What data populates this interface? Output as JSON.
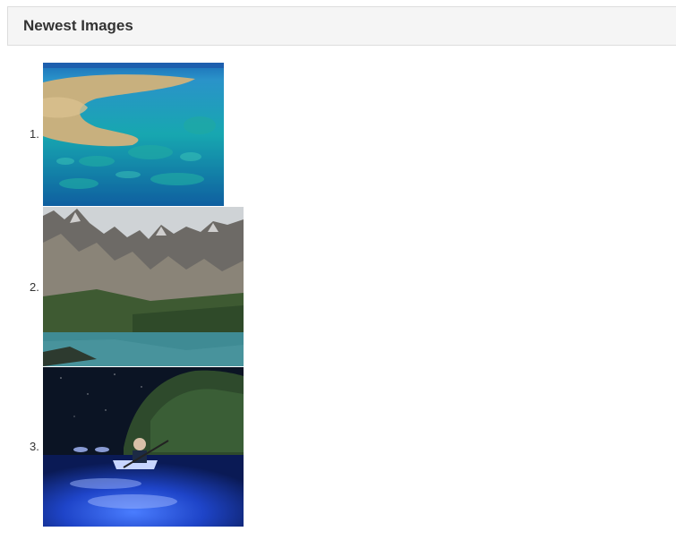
{
  "panel": {
    "title": "Newest Images"
  },
  "images": [
    {
      "number": "1.",
      "icon": "aerial-reef-image"
    },
    {
      "number": "2.",
      "icon": "mountain-lake-image"
    },
    {
      "number": "3.",
      "icon": "night-kayak-image"
    }
  ]
}
